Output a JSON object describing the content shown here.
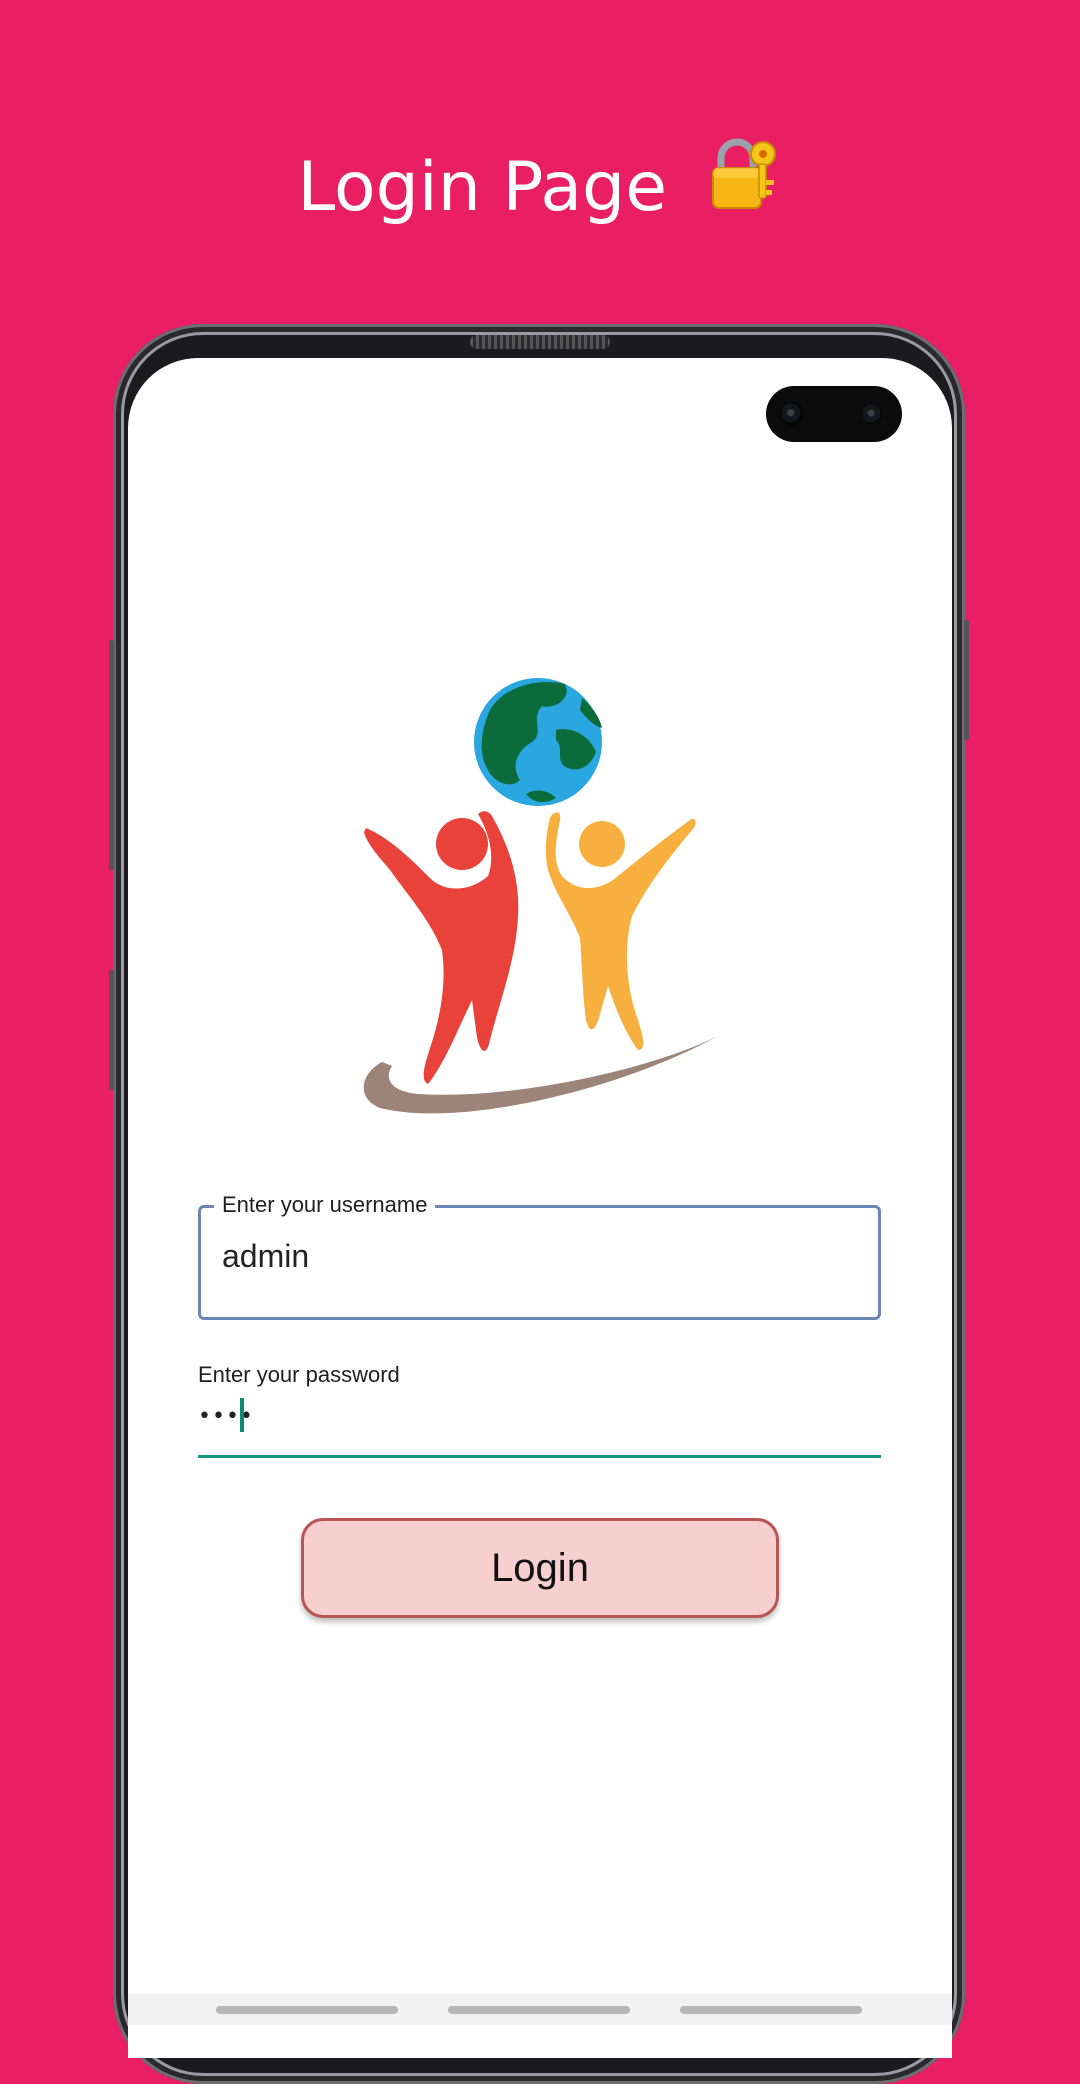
{
  "header": {
    "title": "Login Page",
    "title_icon": "lock-with-key-icon"
  },
  "form": {
    "username": {
      "label": "Enter your username",
      "value": "admin"
    },
    "password": {
      "label": "Enter your password",
      "value": "••••"
    },
    "login_label": "Login"
  },
  "logo": {
    "icon": "globe-people-logo"
  },
  "colors": {
    "background": "#E91E63",
    "field_border": "#6B86B5",
    "password_underline": "#169882",
    "button_fill": "#F7CFCF",
    "button_border": "#B85454"
  }
}
